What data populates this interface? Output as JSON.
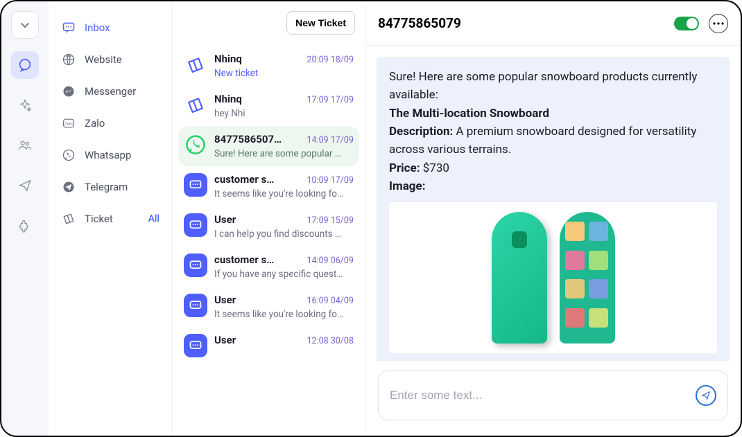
{
  "channels": [
    {
      "id": "inbox",
      "label": "Inbox",
      "icon": "chat-bubble",
      "active": true
    },
    {
      "id": "website",
      "label": "Website",
      "icon": "globe"
    },
    {
      "id": "messenger",
      "label": "Messenger",
      "icon": "messenger"
    },
    {
      "id": "zalo",
      "label": "Zalo",
      "icon": "zalo"
    },
    {
      "id": "whatsapp",
      "label": "Whatsapp",
      "icon": "whatsapp"
    },
    {
      "id": "telegram",
      "label": "Telegram",
      "icon": "telegram"
    },
    {
      "id": "ticket",
      "label": "Ticket",
      "icon": "ticket",
      "badge": "All"
    }
  ],
  "toolbar": {
    "new_ticket": "New Ticket"
  },
  "conversations": [
    {
      "name": "Nhinq",
      "time": "20:09 18/09",
      "preview": "New ticket",
      "icon": "ticket",
      "preview_class": "blue"
    },
    {
      "name": "Nhinq",
      "time": "17:09 17/09",
      "preview": "hey Nhi",
      "icon": "ticket"
    },
    {
      "name": "8477586507…",
      "time": "14:09 17/09",
      "preview": "Sure! Here are some popular …",
      "icon": "whatsapp",
      "selected": true
    },
    {
      "name": "customer s…",
      "time": "10:09 17/09",
      "preview": "It seems like you're looking fo…",
      "icon": "web"
    },
    {
      "name": "User",
      "time": "17:09 15/09",
      "preview": "I can help you find discounts …",
      "icon": "web"
    },
    {
      "name": "customer s…",
      "time": "14:09 06/09",
      "preview": "If you have any specific quest…",
      "icon": "web"
    },
    {
      "name": "User",
      "time": "16:09 04/09",
      "preview": "It seems like you're looking fo…",
      "icon": "web"
    },
    {
      "name": "User",
      "time": "12:08 30/08",
      "preview": "",
      "icon": "web"
    }
  ],
  "thread": {
    "title": "84775865079",
    "message_intro": "Sure! Here are some popular snowboard products currently available:",
    "product_title": "The Multi-location Snowboard",
    "desc_label": "Description:",
    "desc_text": " A premium snowboard designed for versatility across various terrains.",
    "price_label": "Price:",
    "price_text": " $730",
    "image_label": "Image:"
  },
  "composer": {
    "placeholder": "Enter some text..."
  }
}
